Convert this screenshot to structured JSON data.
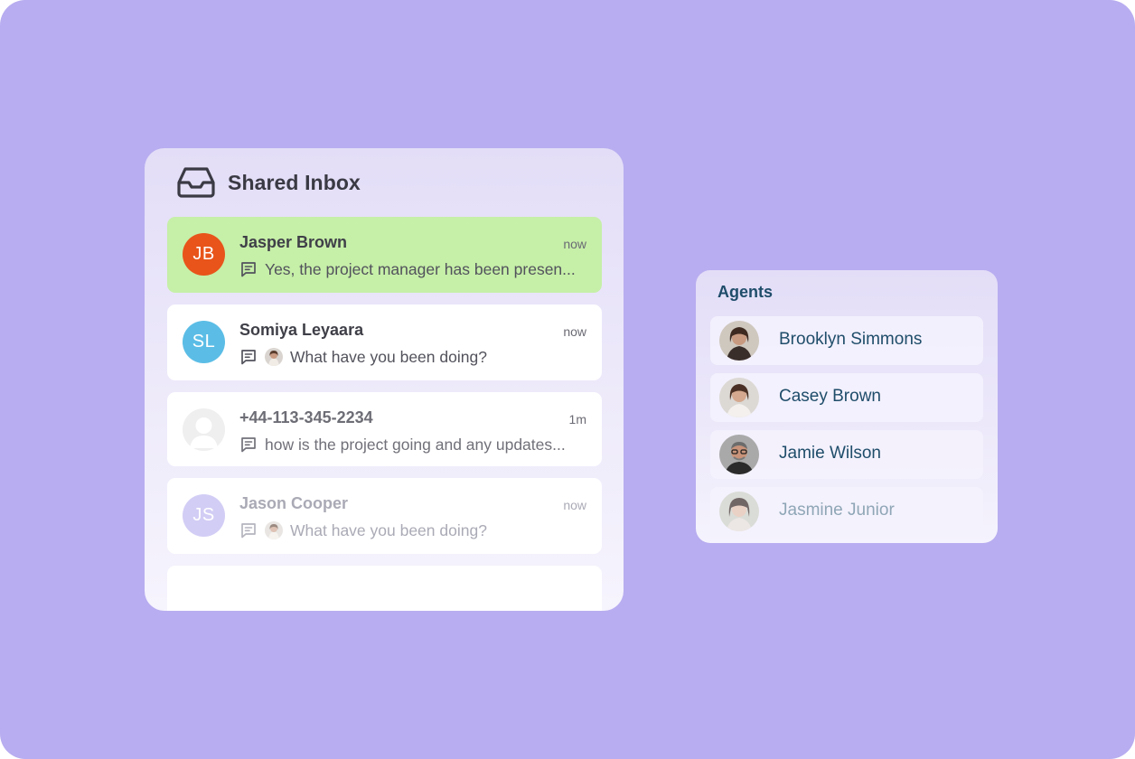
{
  "inbox": {
    "title": "Shared Inbox",
    "icon": "inbox-tray-icon",
    "messages": [
      {
        "initials": "JB",
        "name": "Jasper Brown",
        "time": "now",
        "preview": "Yes, the project manager has been presen...",
        "avatar_color": "#e8541a",
        "highlight_color": "#c6efa8"
      },
      {
        "initials": "SL",
        "name": "Somiya Leyaara",
        "time": "now",
        "preview": "What have you been doing?",
        "avatar_color": "#5bbde6"
      },
      {
        "initials": "",
        "name": "+44-113-345-2234",
        "time": "1m",
        "preview": "how is the project going and any updates..."
      },
      {
        "initials": "JS",
        "name": "Jason Cooper",
        "time": "now",
        "preview": "What have you been doing?",
        "avatar_color": "#d2cdf5"
      }
    ]
  },
  "agents": {
    "title": "Agents",
    "items": [
      {
        "name": "Brooklyn Simmons"
      },
      {
        "name": "Casey Brown"
      },
      {
        "name": "Jamie Wilson"
      },
      {
        "name": "Jasmine Junior"
      }
    ]
  },
  "colors": {
    "background": "#b8adf0",
    "accent_text": "#1f4d6a"
  }
}
